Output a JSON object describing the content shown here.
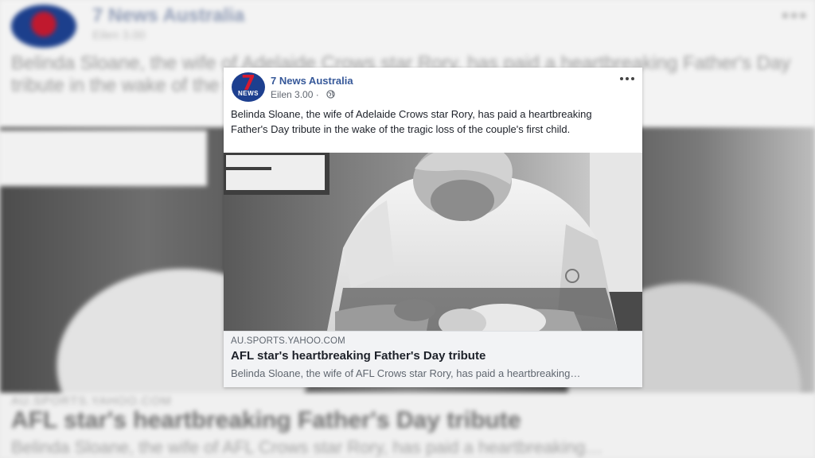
{
  "post": {
    "page_name": "7 News Australia",
    "avatar_text": {
      "number": "7",
      "word": "NEWS"
    },
    "timestamp": "Eilen 3.00",
    "separator": "·",
    "audience_icon": "globe-icon",
    "more_icon": "more-options-icon",
    "text": "Belinda Sloane, the wife of Adelaide Crows star Rory, has paid a heartbreaking Father's Day tribute in the wake of the tragic loss of the couple's first child."
  },
  "link_preview": {
    "domain": "AU.SPORTS.YAHOO.COM",
    "title": "AFL star's heartbreaking Father's Day tribute",
    "snippet": "Belinda Sloane, the wife of AFL Crows star Rory, has paid a heartbreaking…"
  },
  "background": {
    "page_name": "7 News Australia",
    "timestamp": "Eilen 3.00",
    "text": "Belinda Sloane, the wife of Adelaide Crows star Rory, has paid a heartbreaking Father's Day tribute in the wake of the tragic loss of the couple's first child.",
    "domain": "AU.SPORTS.YAHOO.COM",
    "title": "AFL star's heartbreaking Father's Day tribute",
    "snippet": "Belinda Sloane, the wife of AFL Crows star Rory, has paid a heartbreaking…"
  },
  "colors": {
    "page_name": "#365899",
    "brand_red": "#d71a2f",
    "brand_blue": "#1d3f8f",
    "link_panel": "#f2f3f5"
  }
}
